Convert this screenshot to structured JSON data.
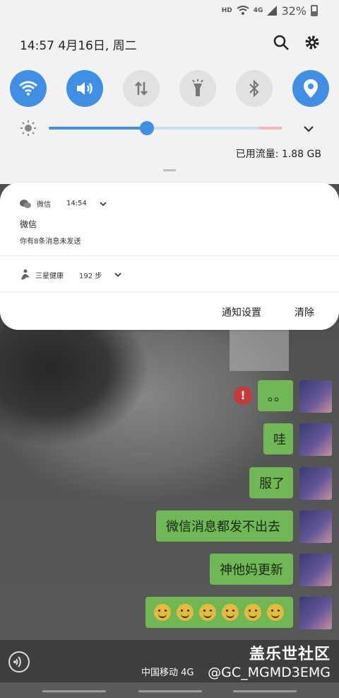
{
  "status_bar": {
    "hd": "HD",
    "net": "4G",
    "battery": "32%"
  },
  "quick_panel": {
    "datetime": "14:57   4月16日, 周二",
    "toggles": [
      {
        "name": "wifi",
        "on": true
      },
      {
        "name": "sound",
        "on": true
      },
      {
        "name": "mobile-data",
        "on": false
      },
      {
        "name": "flashlight",
        "on": false
      },
      {
        "name": "bluetooth",
        "on": false
      },
      {
        "name": "location",
        "on": true
      }
    ],
    "brightness": 0.42,
    "data_usage": "已用流量: 1.88 GB"
  },
  "notifications": {
    "wechat": {
      "app": "微信",
      "time": "14:54",
      "title": "微信",
      "body": "你有8条消息未发送"
    },
    "health": {
      "app": "三星健康",
      "steps": "192 步"
    },
    "actions": {
      "settings": "通知设置",
      "clear": "清除"
    }
  },
  "chat": {
    "bubbles": [
      "。。",
      "哇",
      "服了",
      "微信消息都发不出去",
      "神他妈更新"
    ],
    "emoji_count": 6
  },
  "footer": {
    "carrier": "中国移动 4G",
    "watermark": "盖乐世社区",
    "watermark_handle": "@GC_MGMD3EMG"
  },
  "colors": {
    "accent": "#3f8fe6",
    "chat_bubble": "#76c15a"
  }
}
